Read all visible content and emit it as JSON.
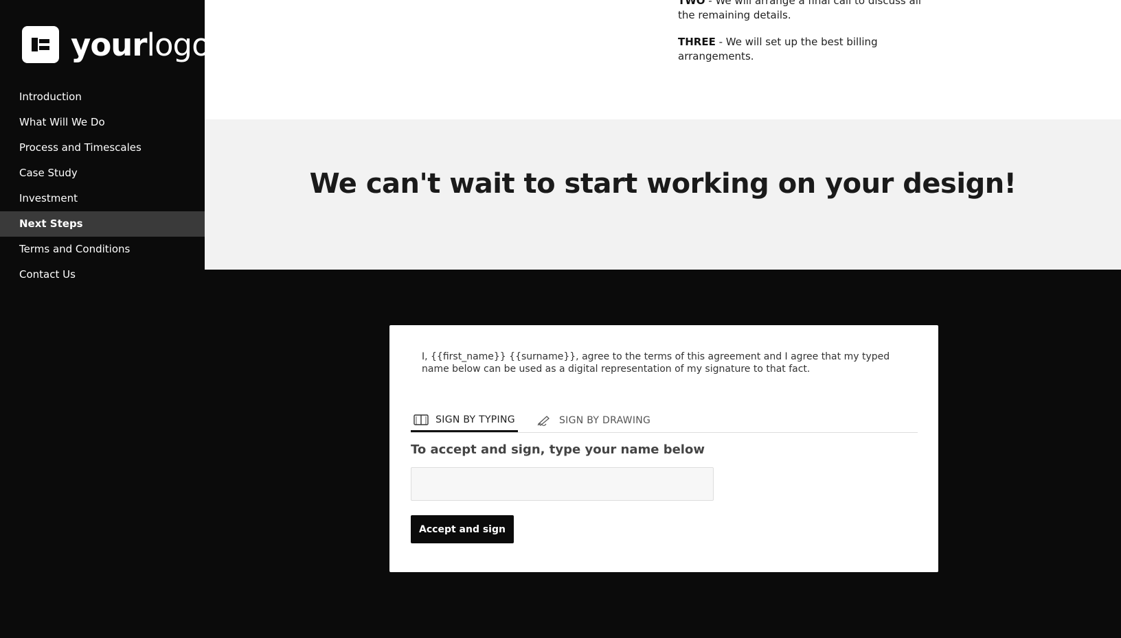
{
  "sidebar": {
    "logo": {
      "bold_part": "your",
      "light_part": "logo",
      "icon": "logo-icon"
    },
    "nav": [
      {
        "label": "Introduction",
        "active": false
      },
      {
        "label": "What Will We Do",
        "active": false
      },
      {
        "label": "Process and Timescales",
        "active": false
      },
      {
        "label": "Case Study",
        "active": false
      },
      {
        "label": "Investment",
        "active": false
      },
      {
        "label": "Next Steps",
        "active": true
      },
      {
        "label": "Terms and Conditions",
        "active": false
      },
      {
        "label": "Contact Us",
        "active": false
      }
    ]
  },
  "steps": {
    "two_label": "TWO",
    "two_text": " - We will arrange a final call to discuss all the remaining details.",
    "three_label": "THREE",
    "three_text": " - We will set up the best billing arrangements."
  },
  "cta": {
    "title": "We can't wait to start working on your design!"
  },
  "signature": {
    "agreement": "I, {{first_name}} {{surname}}, agree to the terms of this agreement and I agree that my typed name below can be used as a digital representation of my signature to that fact.",
    "tabs": [
      {
        "label": "SIGN BY TYPING",
        "icon": "keyboard-icon",
        "active": true
      },
      {
        "label": "SIGN BY DRAWING",
        "icon": "pen-icon",
        "active": false
      }
    ],
    "prompt": "To accept and sign, type your name below",
    "input_value": "",
    "input_placeholder": "",
    "button_label": "Accept and sign"
  },
  "colors": {
    "sidebar_bg": "#0b0b0b",
    "active_nav_bg": "#3a3a3a",
    "cta_bg": "#f2f2f2",
    "button_bg": "#0b0b0b"
  }
}
